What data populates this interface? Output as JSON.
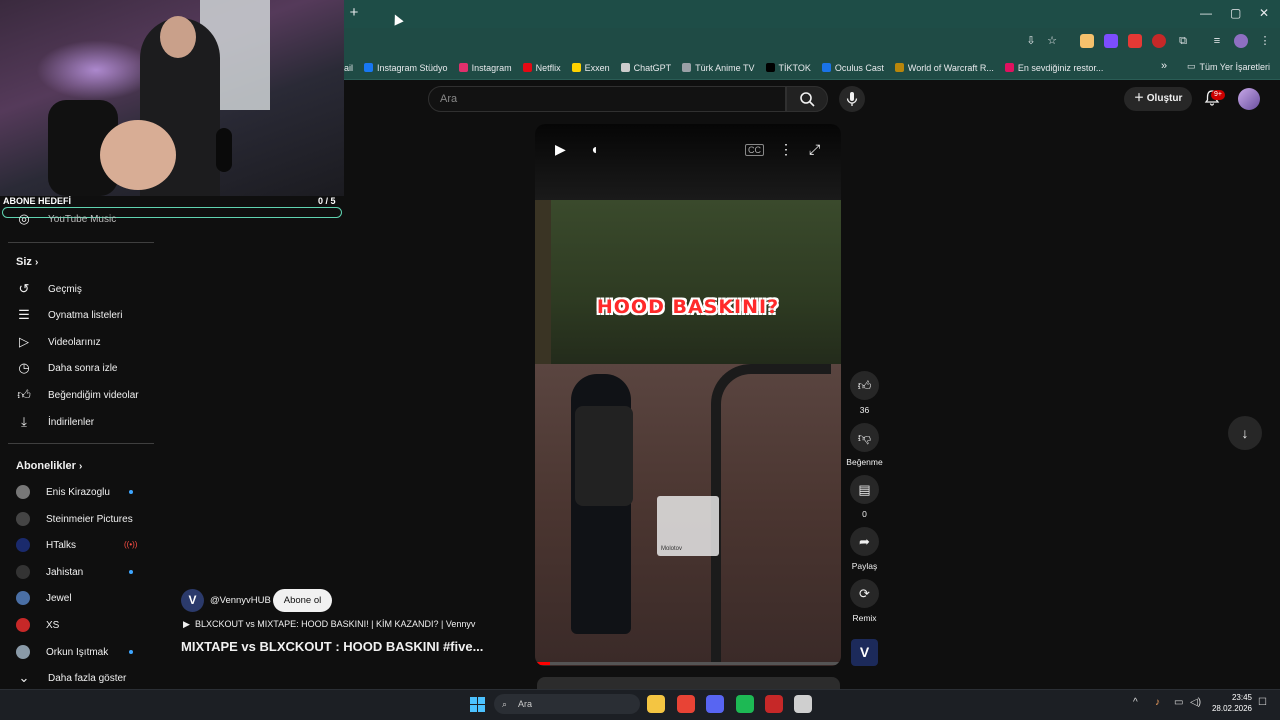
{
  "browser": {
    "new_tab_label": "+",
    "window_controls": [
      "—",
      "▢",
      "✕"
    ],
    "bookmarks": [
      {
        "label": "ail",
        "color": "#2b5f58"
      },
      {
        "label": "Instagram Stüdyo",
        "color": "#1877f2"
      },
      {
        "label": "Instagram",
        "color": "#e1306c"
      },
      {
        "label": "Netflix",
        "color": "#e50914"
      },
      {
        "label": "Exxen",
        "color": "#ffd200"
      },
      {
        "label": "ChatGPT",
        "color": "#cccccc"
      },
      {
        "label": "Türk Anime TV",
        "color": "#9aa0a6"
      },
      {
        "label": "TİKTOK",
        "color": "#000000"
      },
      {
        "label": "Oculus Cast",
        "color": "#1a73e8"
      },
      {
        "label": "World of Warcraft R...",
        "color": "#b8860b"
      },
      {
        "label": "En sevdiğiniz restor...",
        "color": "#e0115f"
      }
    ],
    "bookmarks_more": "»",
    "all_bookmarks": "Tüm Yer İşaretleri"
  },
  "youtube": {
    "search_placeholder": "Ara",
    "create_label": "Oluştur",
    "notification_count": "9+"
  },
  "overlay": {
    "goal_label": "ABONE HEDEFİ",
    "goal_count": "0 / 5",
    "goal_progress": 0
  },
  "sidebar": {
    "music_label": "YouTube Music",
    "you_header": "Siz",
    "you_items": [
      {
        "label": "Geçmiş",
        "icon": "history-icon"
      },
      {
        "label": "Oynatma listeleri",
        "icon": "playlists-icon"
      },
      {
        "label": "Videolarınız",
        "icon": "your-videos-icon"
      },
      {
        "label": "Daha sonra izle",
        "icon": "watch-later-icon"
      },
      {
        "label": "Beğendiğim videolar",
        "icon": "liked-videos-icon"
      },
      {
        "label": "İndirilenler",
        "icon": "downloads-icon"
      }
    ],
    "subs_header": "Abonelikler",
    "subs": [
      {
        "label": "Enis Kirazoglu",
        "avatar": "#777777",
        "status": "dot"
      },
      {
        "label": "Steinmeier Pictures",
        "avatar": "#444444",
        "status": ""
      },
      {
        "label": "HTalks",
        "avatar": "#1a2a6c",
        "status": "live"
      },
      {
        "label": "Jahistan",
        "avatar": "#333333",
        "status": "dot"
      },
      {
        "label": "Jewel",
        "avatar": "#4a6fa5",
        "status": ""
      },
      {
        "label": "XS",
        "avatar": "#c62828",
        "status": ""
      },
      {
        "label": "Orkun Işıtmak",
        "avatar": "#8a9aa8",
        "status": "dot"
      }
    ],
    "show_more": "Daha fazla göster"
  },
  "short": {
    "overlay_title": "HOOD BASKINI?",
    "item_label": "Molotov",
    "progress": 0.05,
    "likes": "36",
    "dislike_label": "Beğenme",
    "comments": "0",
    "share_label": "Paylaş",
    "remix_label": "Remix",
    "channel_handle": "@VennyvHUB",
    "subscribe_label": "Abone ol",
    "related_title": "BLXCKOUT vs MIXTAPE: HOOD BASKINI! | KİM KAZANDI? | Vennyv",
    "title": "MIXTAPE vs BLXCKOUT : HOOD BASKINI  #five..."
  },
  "taskbar": {
    "search_placeholder": "Ara",
    "time": "23:45",
    "date": "28.02.2026",
    "apps": [
      {
        "name": "file-explorer-icon",
        "color": "#f4c542"
      },
      {
        "name": "chrome-icon",
        "color": "#e84335"
      },
      {
        "name": "discord-icon",
        "color": "#5865f2"
      },
      {
        "name": "spotify-icon",
        "color": "#1db954"
      },
      {
        "name": "voicemeeter-icon",
        "color": "#c62828"
      },
      {
        "name": "obs-icon",
        "color": "#cfcfcf"
      }
    ]
  }
}
